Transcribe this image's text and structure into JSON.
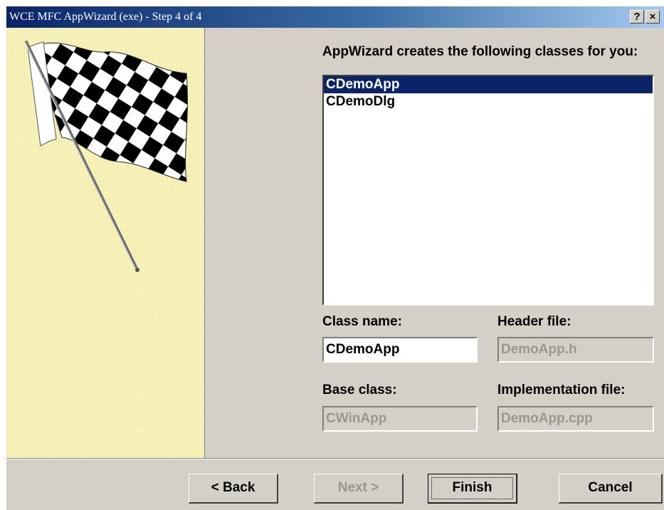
{
  "window": {
    "title": "WCE MFC AppWizard (exe) - Step 4 of 4",
    "help_button": "?",
    "close_button": "×"
  },
  "main": {
    "classes_heading": "AppWizard creates the following classes for you:",
    "classes": [
      "CDemoApp",
      "CDemoDlg"
    ],
    "selected_class": "CDemoApp",
    "class_name_label": "Class name:",
    "class_name_value": "CDemoApp",
    "header_file_label": "Header file:",
    "header_file_value": "DemoApp.h",
    "base_class_label": "Base class:",
    "base_class_value": "CWinApp",
    "implementation_file_label": "Implementation file:",
    "implementation_file_value": "DemoApp.cpp"
  },
  "buttons": {
    "back": "< Back",
    "next": "Next >",
    "finish": "Finish",
    "cancel": "Cancel"
  },
  "colors": {
    "titlebar_start": "#0a246a",
    "dialog_face": "#d4d0c8",
    "selection": "#0a246a",
    "side_panel": "#fdf8c2"
  },
  "icons": [
    "checkered-flag-illustration",
    "help-icon",
    "close-icon"
  ]
}
